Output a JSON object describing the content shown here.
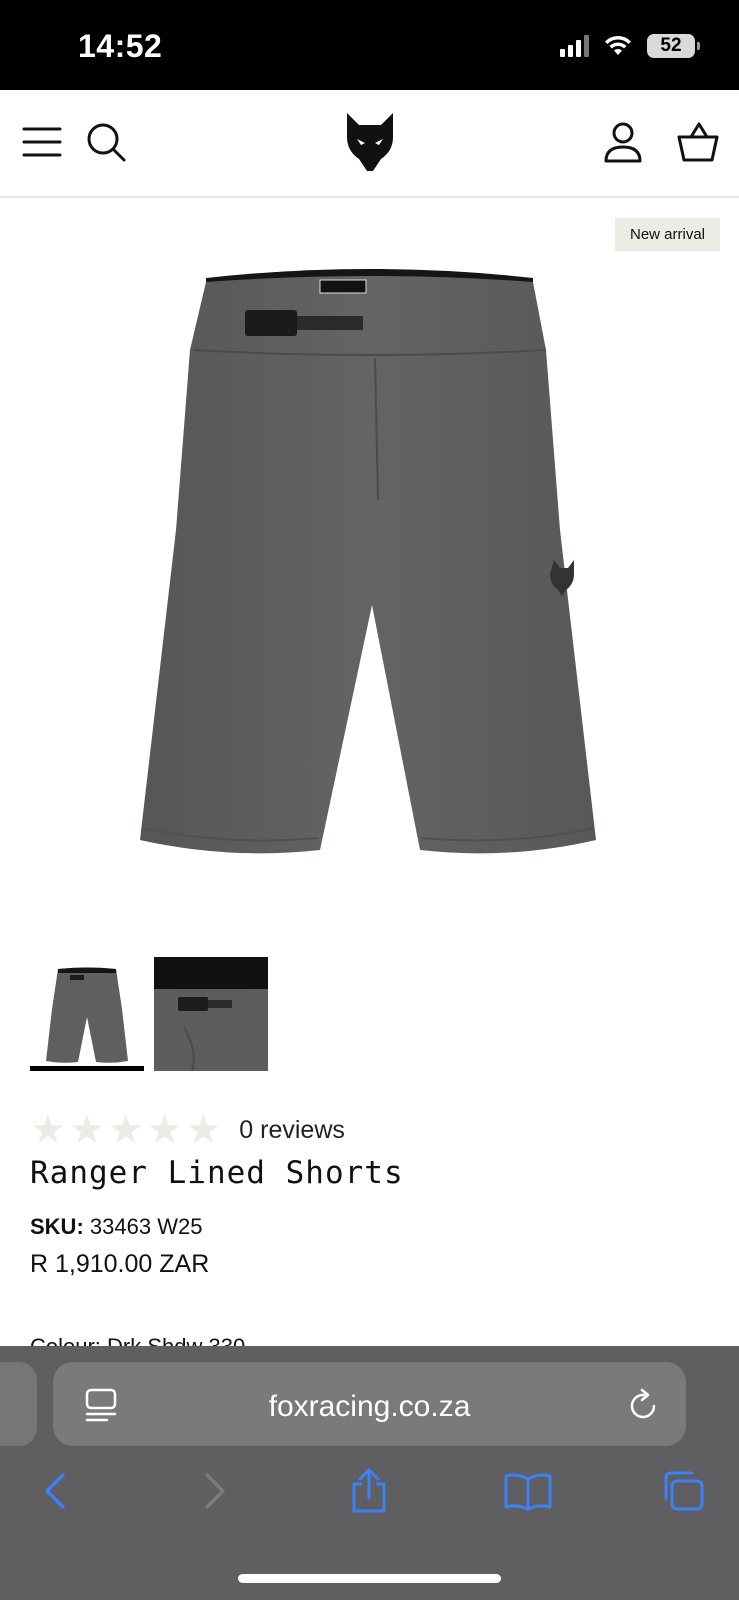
{
  "status_bar": {
    "time": "14:52",
    "battery": "52"
  },
  "header": {
    "menu_icon": "menu-icon",
    "search_icon": "search-icon",
    "logo_icon": "fox-logo-icon",
    "account_icon": "account-icon",
    "cart_icon": "basket-icon"
  },
  "product": {
    "badge": "New arrival",
    "thumbnails": [
      "thumbnail-front",
      "thumbnail-buckle-detail"
    ],
    "rating_stars": 0,
    "reviews_label": "0 reviews",
    "title": "Ranger Lined Shorts",
    "sku_label": "SKU:",
    "sku_value": "33463 W25",
    "price": "R 1,910.00 ZAR",
    "colour_partial": "Colour: Drk Shdw 330"
  },
  "browser": {
    "url": "foxracing.co.za",
    "page_menu_icon": "page-menu-icon",
    "reload_icon": "reload-icon",
    "back_icon": "back-icon",
    "forward_icon": "forward-icon",
    "share_icon": "share-icon",
    "bookmarks_icon": "bookmarks-icon",
    "tabs_icon": "tabs-icon"
  },
  "colors": {
    "shorts": "#5e605f",
    "badge_bg": "#ecebe4",
    "browser_bg": "#5f5f61",
    "accent_blue": "#3b82f6"
  }
}
